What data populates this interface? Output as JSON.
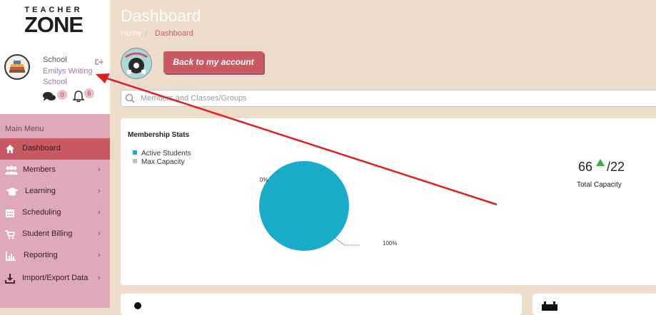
{
  "brand": {
    "top": "TEACHER",
    "main": "ZONE"
  },
  "profile": {
    "label": "School",
    "name": "Emilys Writing School",
    "messages_count": "0",
    "notifications_count": "6"
  },
  "menu": {
    "title": "Main Menu",
    "items": [
      {
        "label": "Dashboard",
        "icon": "home-icon",
        "active": true
      },
      {
        "label": "Members",
        "icon": "members-icon",
        "chevron": "›"
      },
      {
        "label": "Learning",
        "icon": "graduation-cap-icon",
        "chevron": "›"
      },
      {
        "label": "Scheduling",
        "icon": "calendar-icon",
        "chevron": "›"
      },
      {
        "label": "Student Billing",
        "icon": "cart-icon",
        "chevron": "›"
      },
      {
        "label": "Reporting",
        "icon": "bar-chart-icon",
        "chevron": "›"
      },
      {
        "label": "Import/Export Data",
        "icon": "download-icon",
        "chevron": "›"
      }
    ]
  },
  "header": {
    "title": "Dashboard",
    "breadcrumb": {
      "home": "Home",
      "separator": "/",
      "current": "Dashboard"
    }
  },
  "actions": {
    "back_label": "Back to my account"
  },
  "search": {
    "placeholder": "Members and Classes/Groups"
  },
  "stats": {
    "title": "Membership Stats",
    "capacity": {
      "active": "66",
      "max": "/22",
      "label": "Total Capacity"
    }
  },
  "chart_data": {
    "type": "pie",
    "title": "",
    "series": [
      {
        "name": "Active Students",
        "value": 100,
        "label": "100%",
        "color": "#1aabc9"
      },
      {
        "name": "Max Capacity",
        "value": 0,
        "label": "0%",
        "color": "#c0c0c0"
      }
    ],
    "legend": "top-left"
  },
  "colors": {
    "accent": "#c95a64",
    "sidebar": "#dfa9b9",
    "background": "#eedccc",
    "pie_primary": "#1aabc9",
    "annotation_arrow": "#e02020"
  }
}
